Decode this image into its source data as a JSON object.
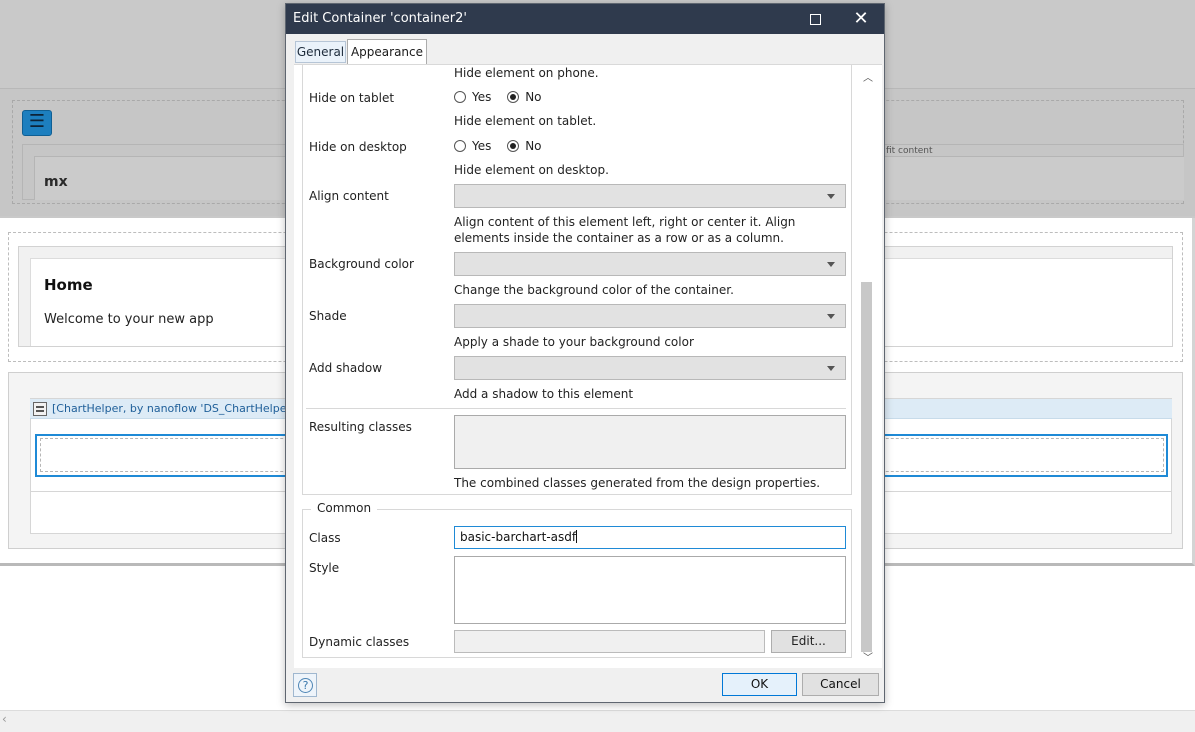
{
  "background": {
    "menu_icon": "hamburger-icon",
    "header_text": "mx",
    "fit_content_text": "fit content",
    "home_title": "Home",
    "home_welcome": "Welcome to your new app",
    "chart_widget_label": "[ChartHelper, by nanoflow 'DS_ChartHelper_Ho"
  },
  "dialog": {
    "title": "Edit Container 'container2'",
    "tabs": [
      {
        "label": "General",
        "active": false
      },
      {
        "label": "Appearance",
        "active": true
      }
    ],
    "fields": {
      "hide_phone_desc": "Hide element on phone.",
      "hide_tablet": {
        "label": "Hide on tablet",
        "yes": "Yes",
        "no": "No",
        "selected": "No",
        "desc": "Hide element on tablet."
      },
      "hide_desktop": {
        "label": "Hide on desktop",
        "yes": "Yes",
        "no": "No",
        "selected": "No",
        "desc": "Hide element on desktop."
      },
      "align_content": {
        "label": "Align content",
        "value": "",
        "desc": "Align content of this element left, right or center it. Align elements inside the container as a row or as a column."
      },
      "background_color": {
        "label": "Background color",
        "value": "",
        "desc": "Change the background color of the container."
      },
      "shade": {
        "label": "Shade",
        "value": "",
        "desc": "Apply a shade to your background color"
      },
      "add_shadow": {
        "label": "Add shadow",
        "value": "",
        "desc": "Add a shadow to this element"
      },
      "resulting_classes": {
        "label": "Resulting classes",
        "value": "",
        "desc": "The combined classes generated from the design properties."
      }
    },
    "common": {
      "legend": "Common",
      "class_label": "Class",
      "class_value": "basic-barchart-asdf",
      "style_label": "Style",
      "style_value": "",
      "dynamic_label": "Dynamic classes",
      "dynamic_value": "",
      "edit_button": "Edit..."
    },
    "buttons": {
      "ok": "OK",
      "cancel": "Cancel",
      "help_icon": "help-icon"
    }
  }
}
